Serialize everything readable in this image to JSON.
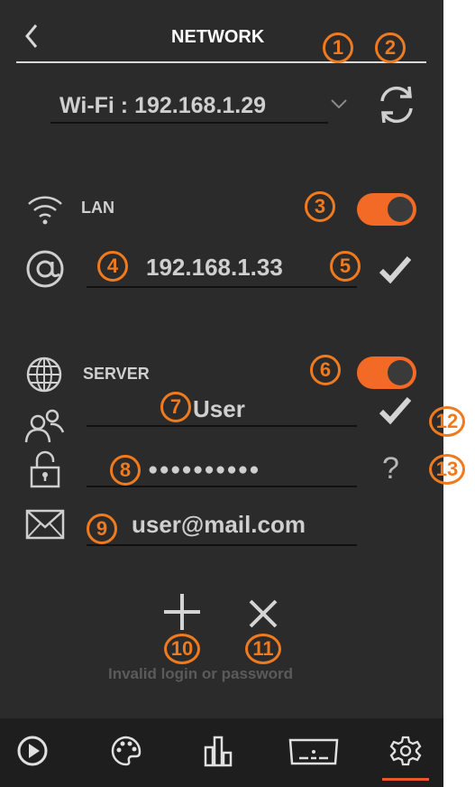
{
  "header": {
    "title": "NETWORK",
    "back_icon": "chevron-left-icon"
  },
  "wifi": {
    "selected": "Wi-Fi : 192.168.1.29",
    "dropdown_icon": "chevron-down-icon",
    "refresh_icon": "refresh-icon"
  },
  "lan": {
    "label": "LAN",
    "enabled": true,
    "ip_value": "192.168.1.33",
    "icon": "wifi-icon",
    "at_icon": "at-sign-icon",
    "confirm_icon": "check-icon"
  },
  "server": {
    "label": "SERVER",
    "enabled": true,
    "username": "User",
    "password_masked": "●●●●●●●●●●",
    "email": "user@mail.com",
    "error_message": "Invalid login or password",
    "icons": {
      "globe": "globe-icon",
      "users": "users-icon",
      "lock": "lock-icon",
      "mail": "mail-icon",
      "help": "?"
    }
  },
  "actions": {
    "add": "+",
    "remove": "×"
  },
  "callouts": [
    "1",
    "2",
    "3",
    "4",
    "5",
    "6",
    "7",
    "8",
    "9",
    "10",
    "11",
    "12",
    "13"
  ],
  "nav": [
    "play-icon",
    "palette-icon",
    "equalizer-icon",
    "display-icon",
    "settings-icon"
  ],
  "colors": {
    "accent": "#f26a25",
    "callout": "#f07a1e",
    "panel": "#2b2b2b",
    "nav": "#1e1e1e"
  }
}
